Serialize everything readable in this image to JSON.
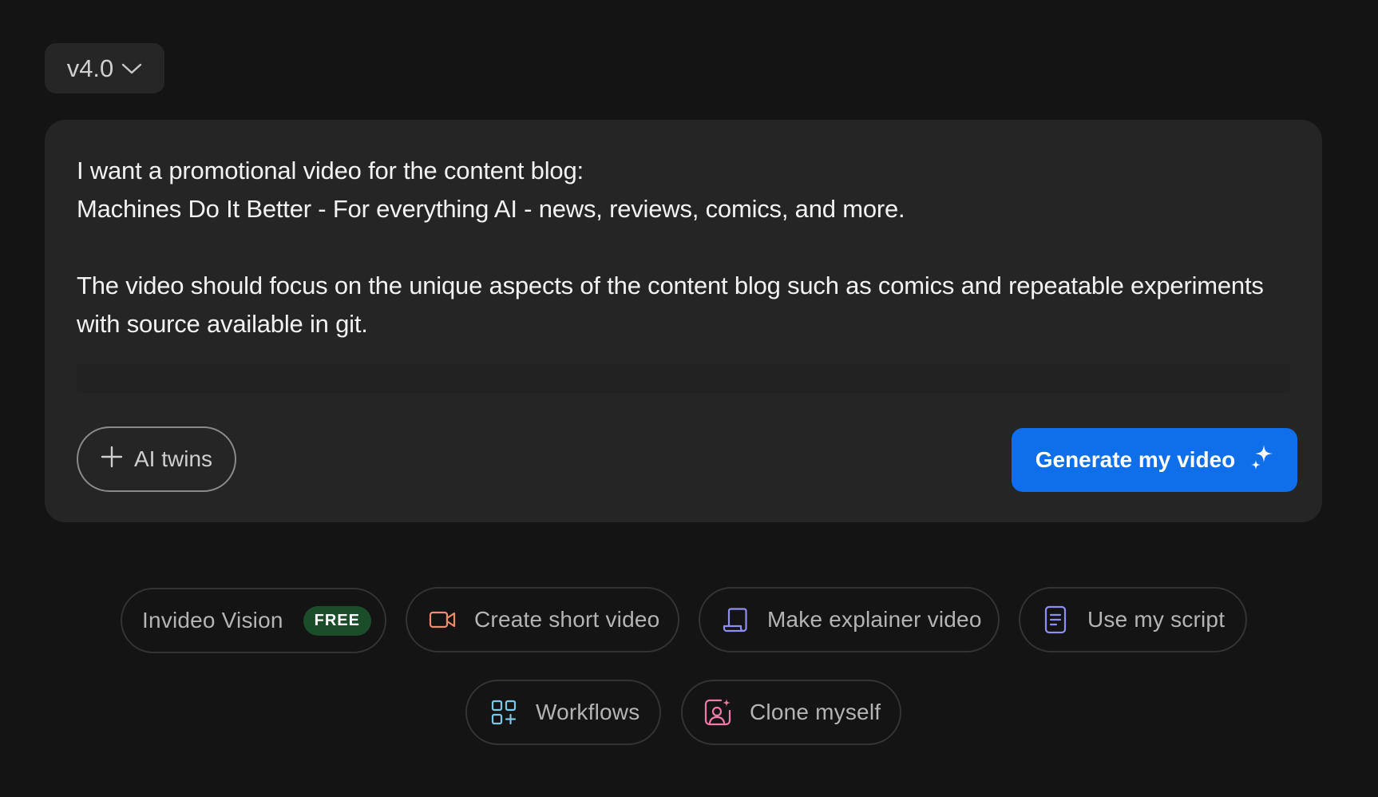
{
  "version_selector": {
    "label": "v4.0"
  },
  "prompt": {
    "text": "I want a promotional video for the content blog:\nMachines Do It Better - For everything AI - news, reviews, comics, and more.\n\nThe video should focus on the unique aspects of the content blog such as comics and repeatable experiments with source available in git."
  },
  "actions": {
    "ai_twins_label": "AI twins",
    "generate_label": "Generate my video"
  },
  "chips": {
    "invideo_vision": {
      "label": "Invideo Vision",
      "badge": "FREE"
    },
    "short_video": {
      "label": "Create short video",
      "icon": "video-camera-icon"
    },
    "explainer_video": {
      "label": "Make explainer video",
      "icon": "scroll-icon"
    },
    "use_script": {
      "label": "Use my script",
      "icon": "document-icon"
    },
    "workflows": {
      "label": "Workflows",
      "icon": "grid-plus-icon"
    },
    "clone_myself": {
      "label": "Clone myself",
      "icon": "portrait-sparkle-icon"
    }
  },
  "colors": {
    "background": "#141414",
    "card": "#252525",
    "accent": "#0f6ee9",
    "free_badge": "#1b4d2b"
  }
}
